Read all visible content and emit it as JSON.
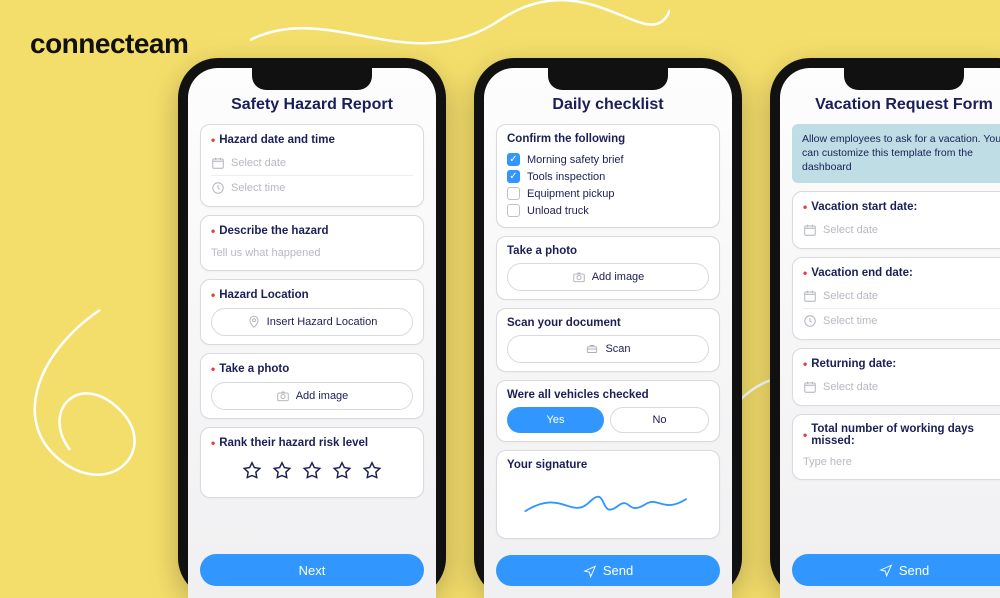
{
  "brand": "connecteam",
  "phone1": {
    "title": "Safety Hazard Report",
    "s1_label": "Hazard date and time",
    "s1_date_ph": "Select date",
    "s1_time_ph": "Select time",
    "s2_label": "Describe the hazard",
    "s2_ph": "Tell us what happened",
    "s3_label": "Hazard Location",
    "s3_ph": "Insert Hazard Location",
    "s4_label": "Take a photo",
    "s4_btn": "Add image",
    "s5_label": "Rank their hazard risk level",
    "cta": "Next"
  },
  "phone2": {
    "title": "Daily checklist",
    "confirm_label": "Confirm the following",
    "c1": "Morning safety brief",
    "c2": "Tools inspection",
    "c3": "Equipment pickup",
    "c4": "Unload truck",
    "photo_label": "Take a photo",
    "photo_btn": "Add image",
    "scan_label": "Scan your document",
    "scan_btn": "Scan",
    "veh_label": "Were all vehicles checked",
    "yes": "Yes",
    "no": "No",
    "sig_label": "Your signature",
    "cta": "Send"
  },
  "phone3": {
    "title": "Vacation Request Form",
    "banner": "Allow employees to ask for a vacation. You can customize this template from the dashboard",
    "s1_label": "Vacation start date:",
    "date_ph": "Select date",
    "s2_label": "Vacation end date:",
    "time_ph": "Select time",
    "s3_label": "Returning date:",
    "s4_label": "Total number of working days missed:",
    "s4_ph": "Type here",
    "cta": "Send"
  }
}
